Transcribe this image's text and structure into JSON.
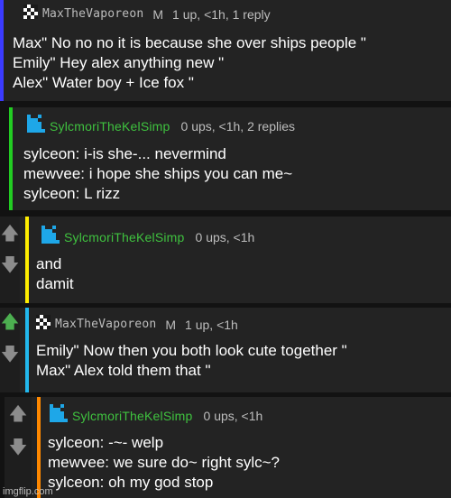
{
  "comments": [
    {
      "username": "MaxTheVaporeon",
      "badge": "M",
      "meta": "1 up, <1h, 1 reply",
      "lines": [
        "Max\" No no no it is because she over ships people \"",
        "Emily\" Hey alex anything new \"",
        "Alex\" Water boy + Ice fox \""
      ],
      "bar_color": "#3b3bff"
    },
    {
      "username": "SylcmoriTheKelSimp",
      "meta": "0 ups, <1h, 2 replies",
      "lines": [
        "sylceon: i-is she-... nevermind",
        "mewvee: i hope she ships you can me~",
        "sylceon: L rizz"
      ],
      "bar_color": "#22cc22"
    },
    {
      "username": "SylcmoriTheKelSimp",
      "meta": "0 ups, <1h",
      "lines": [
        "and",
        "damit"
      ],
      "bar_color": "#ffee00"
    },
    {
      "username": "MaxTheVaporeon",
      "badge": "M",
      "meta": "1 up, <1h",
      "lines": [
        "Emily\" Now then you both look cute together \"",
        "Max\" Alex told them that \""
      ],
      "bar_color": "#22b8ee",
      "upvoted": true
    },
    {
      "username": "SylcmoriTheKelSimp",
      "meta": "0 ups, <1h",
      "lines": [
        "sylceon: -~- welp",
        "mewvee: we sure do~ right sylc~?",
        "sylceon: oh my god stop"
      ],
      "bar_color": "#ff8800"
    }
  ],
  "icons": {
    "upvote": "up-arrow-icon",
    "downvote": "down-arrow-icon",
    "avatar_max": "checker-avatar-icon",
    "avatar_sylc": "blue-pixel-avatar-icon"
  },
  "colors": {
    "username_green": "#3fc23f",
    "upvote_active": "#4caf50"
  },
  "watermark": "imgflip.com"
}
